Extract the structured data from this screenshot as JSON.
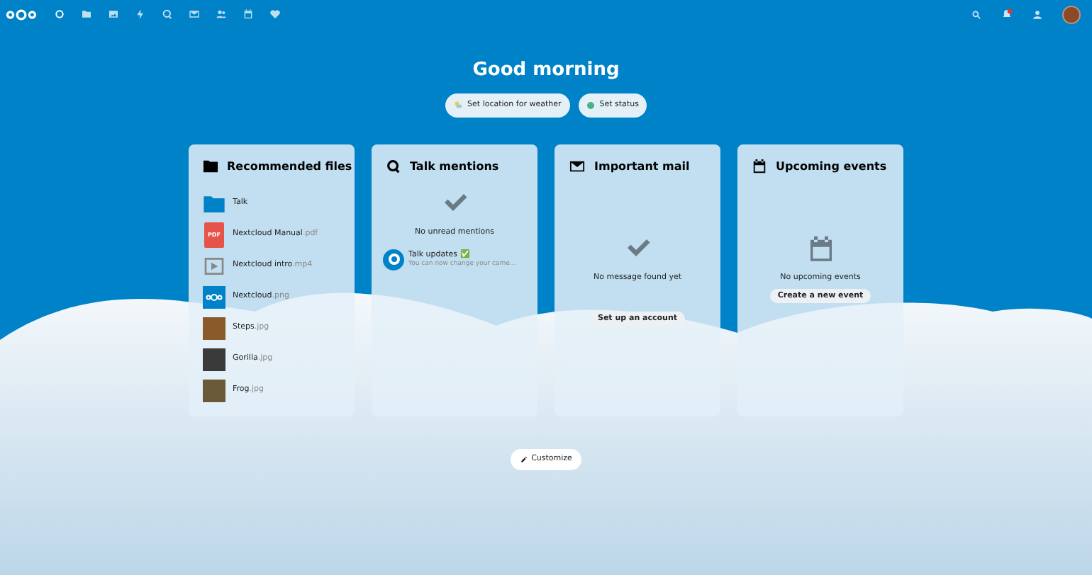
{
  "header": {
    "apps": [
      {
        "kind": "dashboard",
        "selected": true
      },
      {
        "kind": "files",
        "selected": false
      },
      {
        "kind": "photos",
        "selected": false
      },
      {
        "kind": "activity",
        "selected": false
      },
      {
        "kind": "talk",
        "selected": false
      },
      {
        "kind": "mail",
        "selected": false
      },
      {
        "kind": "contacts",
        "selected": false
      },
      {
        "kind": "calendar",
        "selected": false
      },
      {
        "kind": "favorites",
        "selected": false
      }
    ],
    "notifications": {
      "unread": true
    }
  },
  "greeting": "Good morning",
  "actions": [
    {
      "kind": "weather",
      "label": "Set location for weather"
    },
    {
      "kind": "status",
      "label": "Set status"
    }
  ],
  "widgets": [
    {
      "kind": "files",
      "title": "Recommended files",
      "items": [
        {
          "kind": "folder",
          "name": "Talk"
        },
        {
          "kind": "pdf",
          "name": "Nextcloud Manual",
          "ext": ".pdf",
          "badge": "PDF"
        },
        {
          "kind": "video",
          "name": "Nextcloud intro",
          "ext": ".mp4"
        },
        {
          "kind": "logo",
          "name": "Nextcloud",
          "ext": ".png"
        },
        {
          "kind": "photo",
          "name": "Steps",
          "ext": ".jpg"
        },
        {
          "kind": "photo",
          "name": "Gorilla",
          "ext": ".jpg"
        },
        {
          "kind": "photo",
          "name": "Frog",
          "ext": ".jpg"
        }
      ]
    },
    {
      "kind": "mentions",
      "title": "Talk mentions",
      "empty": "No unread mentions",
      "items": [
        {
          "title": "Talk updates ✅",
          "subtitle": "You can now change your came…"
        }
      ]
    },
    {
      "kind": "mail",
      "title": "Important mail",
      "empty": "No message found yet",
      "button": "Set up an account"
    },
    {
      "kind": "events",
      "title": "Upcoming events",
      "empty": "No upcoming events",
      "button": "Create a new event"
    }
  ],
  "customize": "Customize"
}
